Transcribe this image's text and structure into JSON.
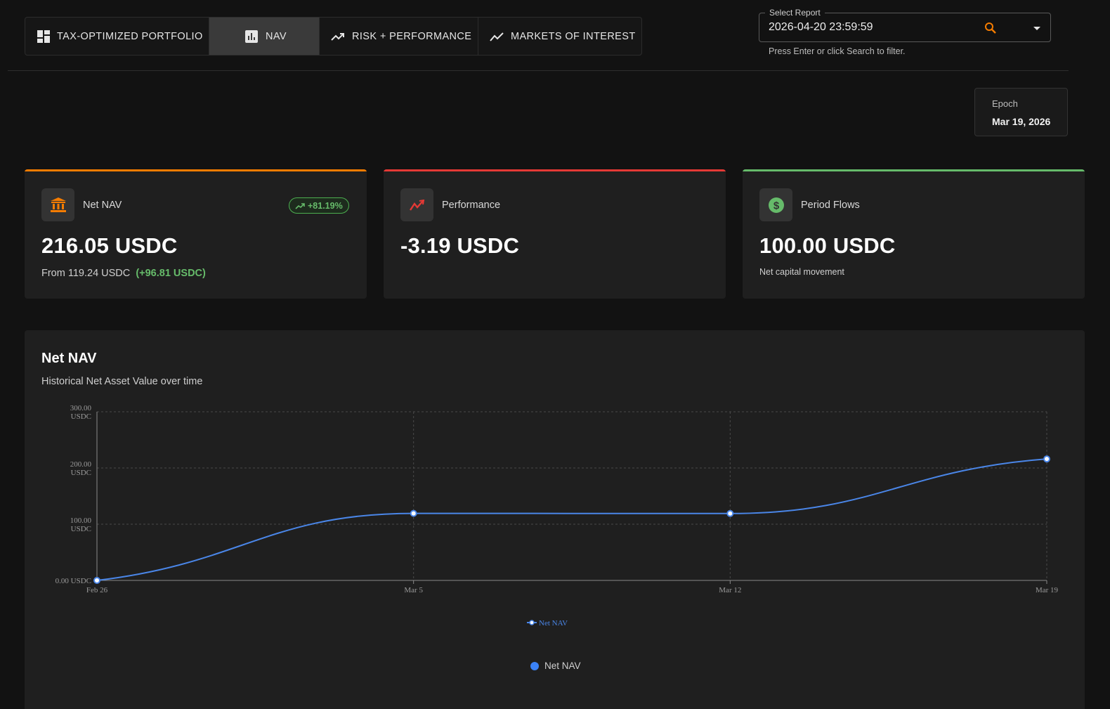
{
  "tabs": [
    {
      "label": "TAX-OPTIMIZED PORTFOLIO",
      "icon": "dashboard-icon",
      "active": false
    },
    {
      "label": "NAV",
      "icon": "bar-chart-icon",
      "active": true
    },
    {
      "label": "RISK + PERFORMANCE",
      "icon": "trending-up-icon",
      "active": false
    },
    {
      "label": "MARKETS OF INTEREST",
      "icon": "line-chart-icon",
      "active": false
    }
  ],
  "report_select": {
    "label": "Select Report",
    "value": "2026-04-20 23:59:59",
    "hint": "Press Enter or click Search to filter."
  },
  "epoch": {
    "label": "Epoch",
    "value": "Mar 19, 2026"
  },
  "cards": {
    "net_nav": {
      "title": "Net NAV",
      "value": "216.05 USDC",
      "badge": "+81.19%",
      "from_text": "From 119.24 USDC",
      "change_text": "(+96.81 USDC)",
      "accent": "#f57c00",
      "icon": "bank-icon"
    },
    "performance": {
      "title": "Performance",
      "value": "-3.19 USDC",
      "accent": "#e53935",
      "icon": "trending-down-icon"
    },
    "period_flows": {
      "title": "Period Flows",
      "value": "100.00 USDC",
      "sub": "Net capital movement",
      "accent": "#66bb6a",
      "icon": "dollar-icon"
    }
  },
  "chart_section": {
    "title": "Net NAV",
    "subtitle": "Historical Net Asset Value over time",
    "legend_label": "Net NAV"
  },
  "colors": {
    "series": "#4a86e8"
  },
  "chart_data": {
    "type": "line",
    "x": [
      "Feb 26",
      "Mar 5",
      "Mar 12",
      "Mar 19"
    ],
    "series": [
      {
        "name": "Net NAV",
        "values": [
          0,
          119.24,
          119.0,
          216.05
        ]
      }
    ],
    "ylim": [
      0,
      300
    ],
    "yticks": [
      {
        "value": 0,
        "label": "0.00 USDC"
      },
      {
        "value": 100,
        "label": "100.00 USDC"
      },
      {
        "value": 200,
        "label": "200.00 USDC"
      },
      {
        "value": 300,
        "label": "300.00 USDC"
      }
    ],
    "grid": true,
    "legend": "bottom"
  }
}
